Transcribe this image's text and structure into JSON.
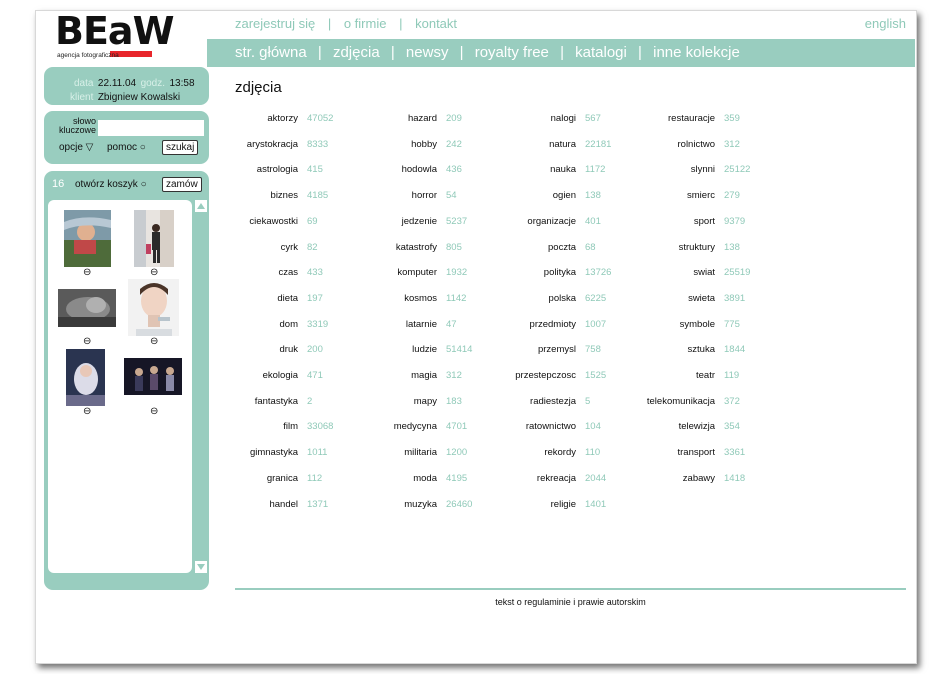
{
  "header": {
    "logo_text": "BEaW",
    "logo_tagline": "agencja fotograficzna",
    "top_links": [
      "zarejestruj się",
      "o firmie",
      "kontakt"
    ],
    "separator": "|",
    "language": "english",
    "nav": [
      "str. główna",
      "zdjęcia",
      "newsy",
      "royalty free",
      "katalogi",
      "inne kolekcje"
    ]
  },
  "info": {
    "date_label": "data",
    "date_value": "22.11.04",
    "time_label": "godz.",
    "time_value": "13:58",
    "client_label": "klient",
    "client_value": "Zbigniew Kowalski"
  },
  "search": {
    "keyword_label": "słowo kluczowe",
    "keyword_value": "",
    "options_label": "opcje ▽",
    "help_label": "pomoc ○",
    "search_button": "szukaj"
  },
  "cart": {
    "count": "16",
    "open_label": "otwórz koszyk ○",
    "order_button": "zamów",
    "remove_icon": "⊖"
  },
  "main": {
    "title": "zdjęcia",
    "categories": [
      [
        {
          "name": "aktorzy",
          "count": "47052"
        },
        {
          "name": "arystokracja",
          "count": "8333"
        },
        {
          "name": "astrologia",
          "count": "415"
        },
        {
          "name": "biznes",
          "count": "4185"
        },
        {
          "name": "ciekawostki",
          "count": "69"
        },
        {
          "name": "cyrk",
          "count": "82"
        },
        {
          "name": "czas",
          "count": "433"
        },
        {
          "name": "dieta",
          "count": "197"
        },
        {
          "name": "dom",
          "count": "3319"
        },
        {
          "name": "druk",
          "count": "200"
        },
        {
          "name": "ekologia",
          "count": "471"
        },
        {
          "name": "fantastyka",
          "count": "2"
        },
        {
          "name": "film",
          "count": "33068"
        },
        {
          "name": "gimnastyka",
          "count": "1011"
        },
        {
          "name": "granica",
          "count": "112"
        },
        {
          "name": "handel",
          "count": "1371"
        }
      ],
      [
        {
          "name": "hazard",
          "count": "209"
        },
        {
          "name": "hobby",
          "count": "242"
        },
        {
          "name": "hodowla",
          "count": "436"
        },
        {
          "name": "horror",
          "count": "54"
        },
        {
          "name": "jedzenie",
          "count": "5237"
        },
        {
          "name": "katastrofy",
          "count": "805"
        },
        {
          "name": "komputer",
          "count": "1932"
        },
        {
          "name": "kosmos",
          "count": "1142"
        },
        {
          "name": "latarnie",
          "count": "47"
        },
        {
          "name": "ludzie",
          "count": "51414"
        },
        {
          "name": "magia",
          "count": "312"
        },
        {
          "name": "mapy",
          "count": "183"
        },
        {
          "name": "medycyna",
          "count": "4701"
        },
        {
          "name": "militaria",
          "count": "1200"
        },
        {
          "name": "moda",
          "count": "4195"
        },
        {
          "name": "muzyka",
          "count": "26460"
        }
      ],
      [
        {
          "name": "nalogi",
          "count": "567"
        },
        {
          "name": "natura",
          "count": "22181"
        },
        {
          "name": "nauka",
          "count": "1172"
        },
        {
          "name": "ogien",
          "count": "138"
        },
        {
          "name": "organizacje",
          "count": "401"
        },
        {
          "name": "poczta",
          "count": "68"
        },
        {
          "name": "polityka",
          "count": "13726"
        },
        {
          "name": "polska",
          "count": "6225"
        },
        {
          "name": "przedmioty",
          "count": "1007"
        },
        {
          "name": "przemysl",
          "count": "758"
        },
        {
          "name": "przestepczosc",
          "count": "1525"
        },
        {
          "name": "radiestezja",
          "count": "5"
        },
        {
          "name": "ratownictwo",
          "count": "104"
        },
        {
          "name": "rekordy",
          "count": "110"
        },
        {
          "name": "rekreacja",
          "count": "2044"
        },
        {
          "name": "religie",
          "count": "1401"
        }
      ],
      [
        {
          "name": "restauracje",
          "count": "359"
        },
        {
          "name": "rolnictwo",
          "count": "312"
        },
        {
          "name": "slynni",
          "count": "25122"
        },
        {
          "name": "smierc",
          "count": "279"
        },
        {
          "name": "sport",
          "count": "9379"
        },
        {
          "name": "struktury",
          "count": "138"
        },
        {
          "name": "swiat",
          "count": "25519"
        },
        {
          "name": "swieta",
          "count": "3891"
        },
        {
          "name": "symbole",
          "count": "775"
        },
        {
          "name": "sztuka",
          "count": "1844"
        },
        {
          "name": "teatr",
          "count": "119"
        },
        {
          "name": "telekomunikacja",
          "count": "372"
        },
        {
          "name": "telewizja",
          "count": "354"
        },
        {
          "name": "transport",
          "count": "3361"
        },
        {
          "name": "zabawy",
          "count": "1418"
        }
      ]
    ]
  },
  "footer": {
    "text": "tekst o regulaminie i prawie autorskim"
  },
  "colors": {
    "accent": "#99cdbf",
    "link": "#8fc9b8",
    "brand_red": "#e8262b"
  }
}
